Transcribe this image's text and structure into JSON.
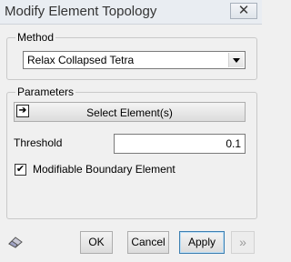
{
  "window": {
    "title": "Modify Element Topology",
    "close_glyph": "✕"
  },
  "method": {
    "legend": "Method",
    "selected": "Relax Collapsed Tetra"
  },
  "parameters": {
    "legend": "Parameters",
    "select_button_label": "Select Element(s)",
    "threshold_label": "Threshold",
    "threshold_value": "0.1",
    "modifiable_boundary_label": "Modifiable Boundary Element",
    "modifiable_boundary_checked": true,
    "check_glyph": "✔"
  },
  "footer": {
    "ok_label": "OK",
    "cancel_label": "Cancel",
    "apply_label": "Apply",
    "more_glyph": "»"
  },
  "icons": {
    "select": "select-element-icon",
    "eraser": "eraser-icon",
    "close": "close-icon"
  }
}
